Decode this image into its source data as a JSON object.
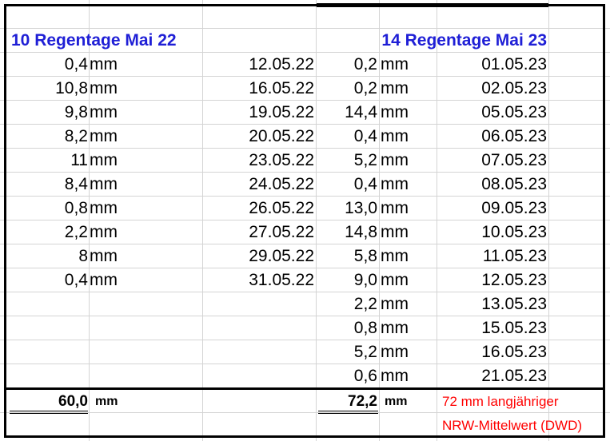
{
  "header": {
    "left_title": "10 Regentage Mai 22",
    "right_title": "14 Regentage Mai 23"
  },
  "unit": "mm",
  "left_rows": [
    {
      "value": "0,4",
      "date": "12.05.22"
    },
    {
      "value": "10,8",
      "date": "16.05.22"
    },
    {
      "value": "9,8",
      "date": "19.05.22"
    },
    {
      "value": "8,2",
      "date": "20.05.22"
    },
    {
      "value": "11",
      "date": "23.05.22"
    },
    {
      "value": "8,4",
      "date": "24.05.22"
    },
    {
      "value": "0,8",
      "date": "26.05.22"
    },
    {
      "value": "2,2",
      "date": "27.05.22"
    },
    {
      "value": "8",
      "date": "29.05.22"
    },
    {
      "value": "0,4",
      "date": "31.05.22"
    }
  ],
  "right_rows": [
    {
      "value": "0,2",
      "date": "01.05.23"
    },
    {
      "value": "0,2",
      "date": "02.05.23"
    },
    {
      "value": "14,4",
      "date": "05.05.23"
    },
    {
      "value": "0,4",
      "date": "06.05.23"
    },
    {
      "value": "5,2",
      "date": "07.05.23"
    },
    {
      "value": "0,4",
      "date": "08.05.23"
    },
    {
      "value": "13,0",
      "date": "09.05.23"
    },
    {
      "value": "14,8",
      "date": "10.05.23"
    },
    {
      "value": "5,8",
      "date": "11.05.23"
    },
    {
      "value": "9,0",
      "date": "12.05.23"
    },
    {
      "value": "2,2",
      "date": "13.05.23"
    },
    {
      "value": "0,8",
      "date": "15.05.23"
    },
    {
      "value": "5,2",
      "date": "16.05.23"
    },
    {
      "value": "0,6",
      "date": "21.05.23"
    }
  ],
  "totals": {
    "left_total": "60,0",
    "left_unit": "mm",
    "right_total": "72,2",
    "right_unit": "mm"
  },
  "note": {
    "line1": "72 mm langjähriger",
    "line2": "NRW-Mittelwert (DWD)"
  },
  "colors": {
    "header_blue": "#1f1fd6",
    "note_red": "#ff0000",
    "gridline": "#d4d4d4",
    "frame": "#000000"
  }
}
